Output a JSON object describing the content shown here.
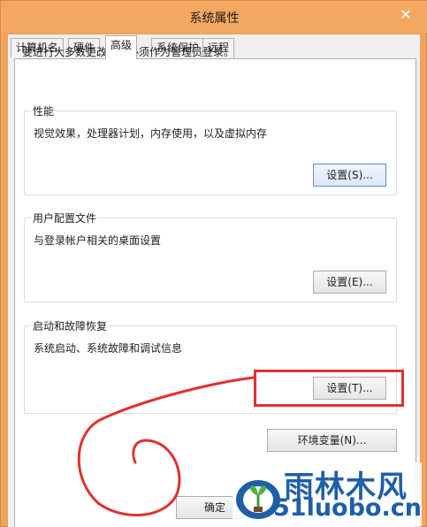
{
  "window": {
    "title": "系统属性",
    "close_glyph": "✕"
  },
  "tabs": [
    {
      "label": "计算机名"
    },
    {
      "label": "硬件"
    },
    {
      "label": "高级"
    },
    {
      "label": "系统保护"
    },
    {
      "label": "远程"
    }
  ],
  "active_tab": "高级",
  "advanced": {
    "admin_note": "要进行大多数更改，你必须作为管理员登录。",
    "performance": {
      "legend": "性能",
      "description": "视觉效果，处理器计划，内存使用，以及虚拟内存",
      "button": "设置(S)..."
    },
    "user_profiles": {
      "legend": "用户配置文件",
      "description": "与登录帐户相关的桌面设置",
      "button": "设置(E)..."
    },
    "startup_recovery": {
      "legend": "启动和故障恢复",
      "description": "系统启动、系统故障和调试信息",
      "button": "设置(T)..."
    },
    "env_button": "环境变量(N)..."
  },
  "footer": {
    "ok_button": "确定"
  },
  "watermark": {
    "top": "雨林木风",
    "bottom": "51luobo.cn"
  },
  "colors": {
    "title_bar": "#f3a862",
    "annotation_red": "#e03131",
    "watermark_blue": "#1e5fa8"
  }
}
